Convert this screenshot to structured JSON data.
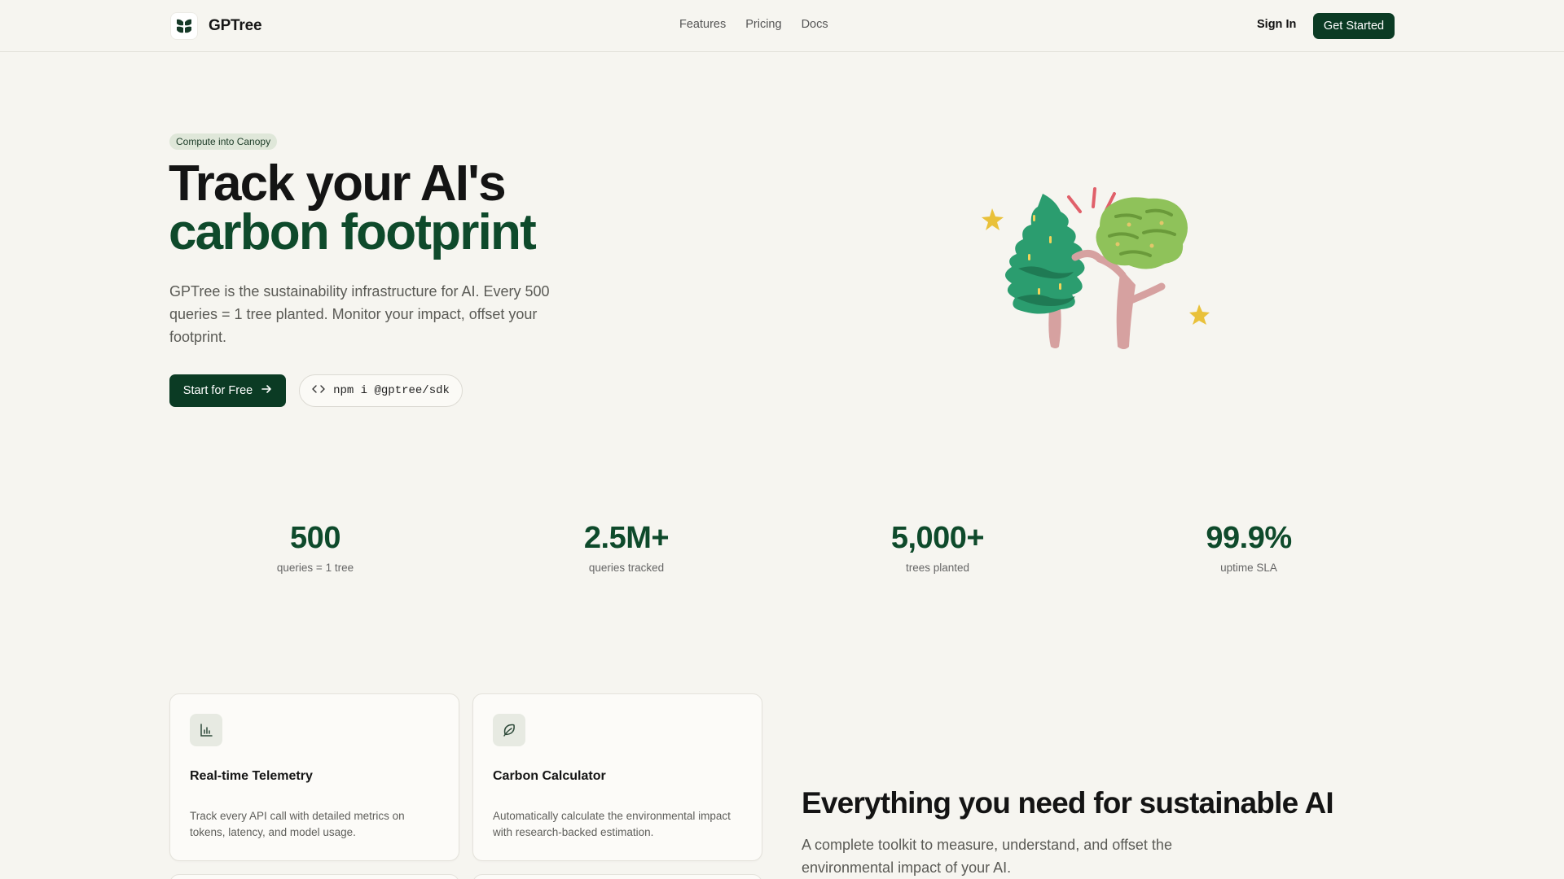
{
  "nav": {
    "brand": "GPTree",
    "links": [
      "Features",
      "Pricing",
      "Docs"
    ],
    "signin": "Sign In",
    "cta": "Get Started"
  },
  "hero": {
    "badge": "Compute into Canopy",
    "title_line1": "Track your AI's",
    "title_line2": "carbon footprint",
    "subtitle": "GPTree is the sustainability infrastructure for AI. Every 500 queries = 1 tree planted. Monitor your impact, offset your footprint.",
    "primary_button": "Start for Free",
    "install_command": "npm i @gptree/sdk"
  },
  "stats": [
    {
      "value": "500",
      "label": "queries = 1 tree"
    },
    {
      "value": "2.5M+",
      "label": "queries tracked"
    },
    {
      "value": "5,000+",
      "label": "trees planted"
    },
    {
      "value": "99.9%",
      "label": "uptime SLA"
    }
  ],
  "features": [
    {
      "icon": "bar-chart-icon",
      "title": "Real-time Telemetry",
      "description": "Track every API call with detailed metrics on tokens, latency, and model usage."
    },
    {
      "icon": "leaf-icon",
      "title": "Carbon Calculator",
      "description": "Automatically calculate the environmental impact with research-backed estimation."
    }
  ],
  "section": {
    "title": "Everything you need for sustainable AI",
    "subtitle": "A complete toolkit to measure, understand, and offset the environmental impact of your AI."
  },
  "colors": {
    "brand_dark": "#0b3b24",
    "brand_green": "#0e4a2b",
    "background": "#f6f5f0",
    "badge_bg": "#dfe7d9"
  }
}
